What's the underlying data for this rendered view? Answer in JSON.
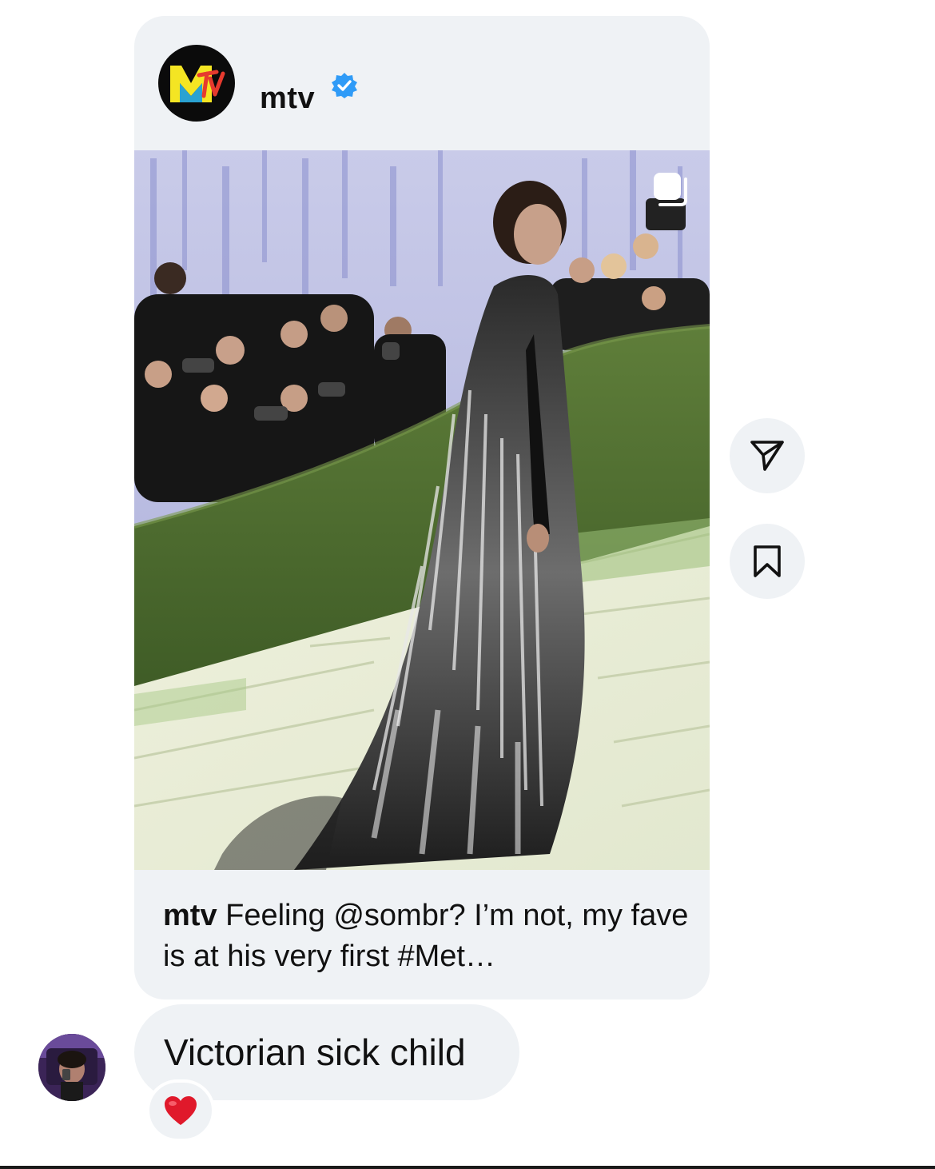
{
  "shared_post": {
    "username": "mtv",
    "verified": true,
    "avatar_logo": "mtv-logo",
    "media_type_icon": "multiple-media-icon",
    "caption_user": "mtv",
    "caption_text": " Feeling @sombr? I’m not, my fave is at his very first #Met…"
  },
  "side_actions": {
    "share_icon": "paper-plane-icon",
    "save_icon": "bookmark-icon"
  },
  "message": {
    "text": "Victorian sick child",
    "reaction": "❤️"
  },
  "colors": {
    "bubble_bg": "#eff2f5",
    "verified_blue": "#2f9bf7",
    "mtv_yellow": "#f4e523",
    "reaction_red": "#e0192b"
  }
}
